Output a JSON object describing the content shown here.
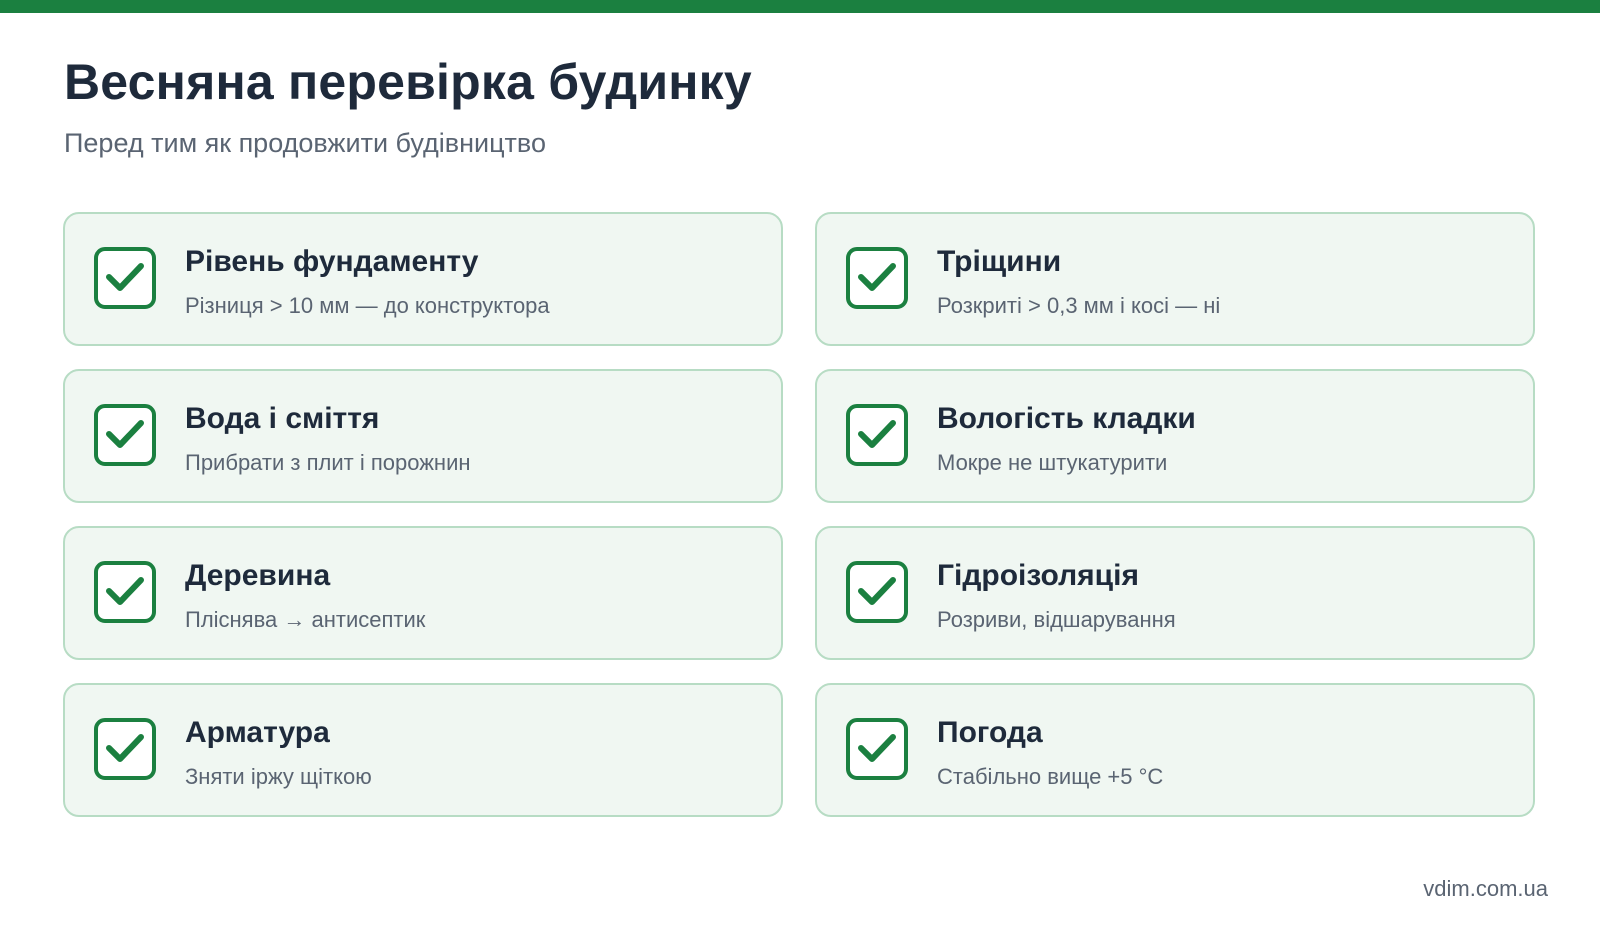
{
  "header": {
    "title": "Весняна перевірка будинку",
    "subtitle": "Перед тим як продовжити будівництво"
  },
  "checklist": [
    {
      "title": "Рівень фундаменту",
      "desc": "Різниця > 10 мм — до конструктора",
      "checked": true
    },
    {
      "title": "Тріщини",
      "desc": "Розкриті > 0,3 мм і косі — ні",
      "checked": true
    },
    {
      "title": "Вода і сміття",
      "desc": "Прибрати з плит і порожнин",
      "checked": true
    },
    {
      "title": "Вологість кладки",
      "desc": "Мокре не штукатурити",
      "checked": true
    },
    {
      "title": "Деревина",
      "desc": "Пліснява → антисептик",
      "checked": true
    },
    {
      "title": "Гідроізоляція",
      "desc": "Розриви, відшарування",
      "checked": true
    },
    {
      "title": "Арматура",
      "desc": "Зняти іржу щіткою",
      "checked": true
    },
    {
      "title": "Погода",
      "desc": "Стабільно вище +5 °C",
      "checked": true
    }
  ],
  "footer": {
    "site": "vdim.com.ua"
  },
  "colors": {
    "accent": "#1b8040",
    "card_bg": "#f0f7f2",
    "card_border": "#b7dcc4",
    "title_text": "#1e2a3b",
    "muted_text": "#5a6472"
  },
  "icons": {
    "check": "checkbox-checked-icon"
  }
}
